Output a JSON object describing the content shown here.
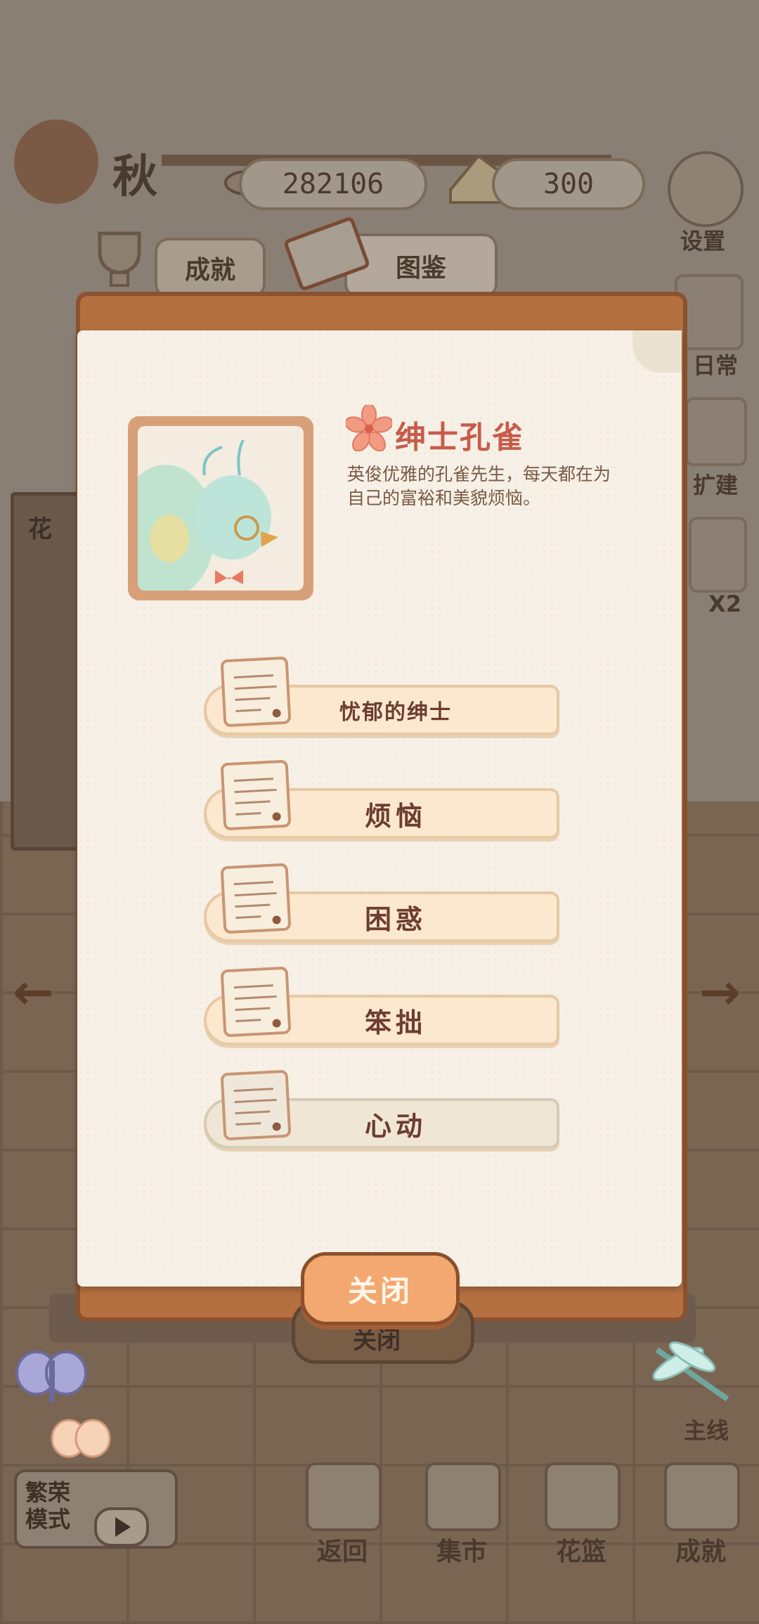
{
  "hud": {
    "season": "秋",
    "fish_count": "282106",
    "cheese_count": "300"
  },
  "tabs": {
    "achievements": "成就",
    "collection": "图鉴"
  },
  "side_menu": {
    "settings": "设置",
    "daily": "日常",
    "build": "扩建",
    "double": "X2",
    "mainline": "主线"
  },
  "left_cabinet_label": "花",
  "character": {
    "name": "绅士孔雀",
    "description": "英俊优雅的孔雀先生，每天都在为自己的富裕和美貌烦恼。"
  },
  "stories": [
    {
      "label": "忧郁的绅士",
      "locked": false
    },
    {
      "label": "烦恼",
      "locked": false
    },
    {
      "label": "困惑",
      "locked": false
    },
    {
      "label": "笨拙",
      "locked": false
    },
    {
      "label": "心动",
      "locked": true
    }
  ],
  "close_button": "关闭",
  "close_button_shadow": "关闭",
  "mode": {
    "label": "繁荣模式"
  },
  "bottom_nav": [
    {
      "label": "返回",
      "icon": "window-icon"
    },
    {
      "label": "集市",
      "icon": "market-stall-icon"
    },
    {
      "label": "花篮",
      "icon": "flower-basket-icon"
    },
    {
      "label": "成就",
      "icon": "trophy-icon"
    }
  ],
  "colors": {
    "panel_border": "#b5703f",
    "paper": "#f6f0e6",
    "name_red": "#c65c4a",
    "close_orange": "#f3a871"
  }
}
